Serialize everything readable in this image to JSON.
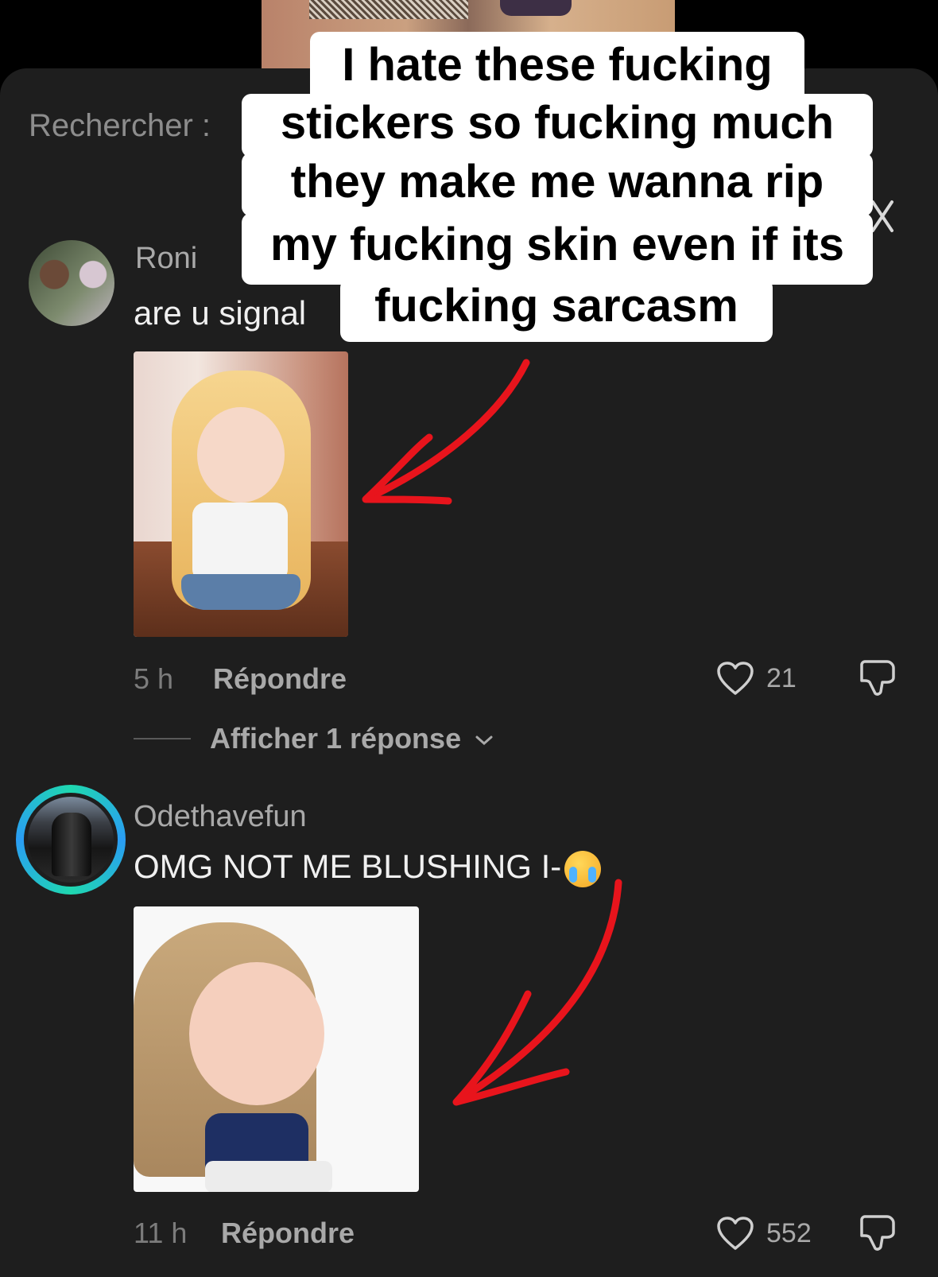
{
  "search": {
    "label": "Rechercher :"
  },
  "caption": {
    "lines": [
      "I hate these fucking",
      "stickers so fucking much",
      "they make me wanna rip",
      "my fucking skin even if its",
      "fucking sarcasm"
    ],
    "color": "#ffffff",
    "text_color": "#000000"
  },
  "comments": [
    {
      "username": "Roni",
      "text": "are u signal",
      "time": "5 h",
      "reply_label": "Répondre",
      "likes": "21",
      "view_replies": "Afficher 1 réponse"
    },
    {
      "username": "Odethavefun",
      "text": "OMG NOT ME BLUSHING I-",
      "time": "11 h",
      "reply_label": "Répondre",
      "likes": "552"
    }
  ],
  "colors": {
    "sheet_background": "#1e1e1e",
    "arrow": "#e8141c",
    "story_ring": [
      "#1fd8b0",
      "#2a9df4"
    ]
  }
}
